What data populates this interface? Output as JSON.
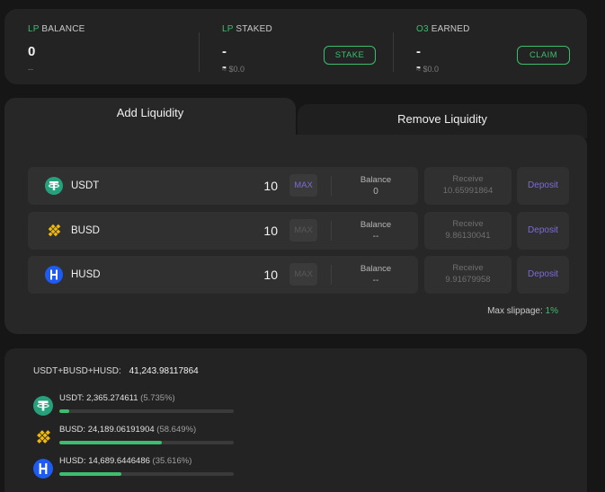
{
  "stats": {
    "lp_balance": {
      "label_accent": "LP",
      "label_rest": " BALANCE",
      "value": "0",
      "sub": "--"
    },
    "lp_staked": {
      "label_accent": "LP",
      "label_rest": " STAKED",
      "value": "--",
      "sub": "≈ $0.0",
      "button": "STAKE"
    },
    "o3_earned": {
      "label_accent": "O3",
      "label_rest": " EARNED",
      "value": "--",
      "sub": "≈ $0.0",
      "button": "CLAIM"
    }
  },
  "tabs": {
    "add": "Add Liquidity",
    "remove": "Remove Liquidity"
  },
  "rows": [
    {
      "coin": "USDT",
      "amount": "10",
      "max": "MAX",
      "balance_label": "Balance",
      "balance": "0",
      "receive_label": "Receive",
      "receive": "10.65991864",
      "deposit": "Deposit",
      "icon": "usdt-icon"
    },
    {
      "coin": "BUSD",
      "amount": "10",
      "max": "MAX",
      "balance_label": "Balance",
      "balance": "--",
      "receive_label": "Receive",
      "receive": "9.86130041",
      "deposit": "Deposit",
      "icon": "busd-icon"
    },
    {
      "coin": "HUSD",
      "amount": "10",
      "max": "MAX",
      "balance_label": "Balance",
      "balance": "--",
      "receive_label": "Receive",
      "receive": "9.91679958",
      "deposit": "Deposit",
      "icon": "husd-icon"
    }
  ],
  "slippage": {
    "label": "Max slippage:",
    "value": "1%"
  },
  "pool": {
    "total_label": "USDT+BUSD+HUSD:",
    "total_value": "41,243.98117864",
    "items": [
      {
        "name": "USDT:",
        "amount": "2,365.274611",
        "pct": "(5.735%)",
        "share": 5.735,
        "icon": "usdt-icon"
      },
      {
        "name": "BUSD:",
        "amount": "24,189.06191904",
        "pct": "(58.649%)",
        "share": 58.649,
        "icon": "busd-icon"
      },
      {
        "name": "HUSD:",
        "amount": "14,689.6446486",
        "pct": "(35.616%)",
        "share": 35.616,
        "icon": "husd-icon"
      }
    ]
  },
  "colors": {
    "accent": "#3dbd6e",
    "purple": "#7c6bd6",
    "usdt": "#26a17b",
    "busd": "#f0b90b",
    "husd": "#1e5bf0"
  }
}
